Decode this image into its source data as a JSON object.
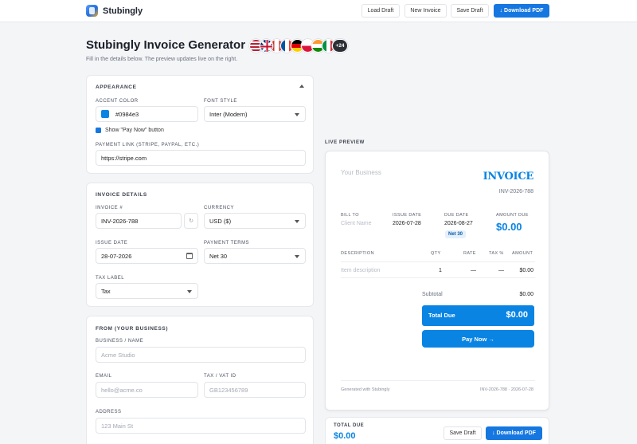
{
  "header": {
    "brand": "Stubingly",
    "load_draft": "Load Draft",
    "new_invoice": "New Invoice",
    "save_draft": "Save Draft",
    "download_pdf": "↓ Download PDF"
  },
  "title": "Stubingly Invoice Generator",
  "subtitle": "Fill in the details below. The preview updates live on the right.",
  "languages_more": "+24",
  "appearance": {
    "section": "APPEARANCE",
    "accent_label": "ACCENT COLOR",
    "accent_value": "#0984e3",
    "font_label": "FONT STYLE",
    "font_value": "Inter (Modern)",
    "pay_now_checkbox": "Show \"Pay Now\" button",
    "payment_link_label": "PAYMENT LINK (STRIPE, PAYPAL, ETC.)",
    "payment_link_value": "https://stripe.com"
  },
  "details": {
    "section": "INVOICE DETAILS",
    "invoice_no_label": "INVOICE #",
    "invoice_no_value": "INV-2026-788",
    "currency_label": "CURRENCY",
    "currency_value": "USD ($)",
    "issue_date_label": "ISSUE DATE",
    "issue_date_value": "28-07-2026",
    "terms_label": "PAYMENT TERMS",
    "terms_value": "Net 30",
    "tax_label_label": "TAX LABEL",
    "tax_label_value": "Tax"
  },
  "from": {
    "section": "FROM (YOUR BUSINESS)",
    "name_label": "BUSINESS / NAME",
    "name_placeholder": "Acme Studio",
    "email_label": "EMAIL",
    "email_placeholder": "hello@acme.co",
    "vat_label": "TAX / VAT ID",
    "vat_placeholder": "GB123456789",
    "address_label": "ADDRESS",
    "address_placeholder": "123 Main St"
  },
  "preview": {
    "label": "LIVE PREVIEW",
    "business": "Your Business",
    "invoice_word": "INVOICE",
    "invoice_no": "INV-2026-788",
    "bill_to": "BILL TO",
    "client": "Client Name",
    "issue_date_h": "ISSUE DATE",
    "issue_date": "2026-07-28",
    "due_date_h": "DUE DATE",
    "due_date": "2026-08-27",
    "terms_badge": "Net 30",
    "amount_due_h": "AMOUNT DUE",
    "amount_due": "$0.00",
    "col_description": "DESCRIPTION",
    "col_qty": "QTY",
    "col_rate": "RATE",
    "col_tax": "TAX %",
    "col_amount": "AMOUNT",
    "item_description": "Item description",
    "item_qty": "1",
    "item_rate": "—",
    "item_tax": "—",
    "item_amount": "$0.00",
    "subtotal_label": "Subtotal",
    "subtotal_value": "$0.00",
    "total_due_label": "Total Due",
    "total_due_value": "$0.00",
    "pay_now": "Pay Now →",
    "generated": "Generated with Stubingly",
    "footer_ref": "INV-2026-788 · 2026-07-28",
    "accent": "#0984e3"
  },
  "bottom": {
    "total_label": "TOTAL DUE",
    "total_value": "$0.00",
    "save_draft": "Save Draft",
    "download_pdf": "↓ Download PDF"
  }
}
